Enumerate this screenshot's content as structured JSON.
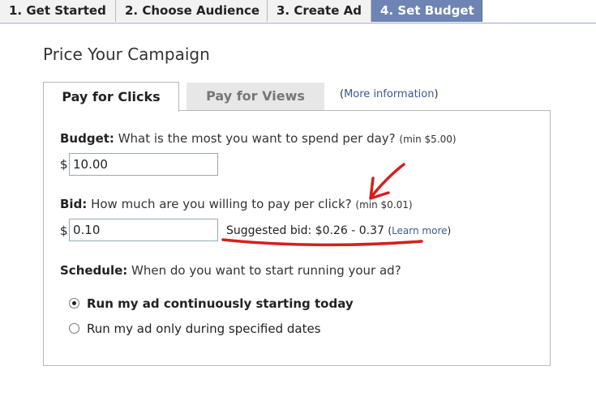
{
  "steps": [
    {
      "label": "1. Get Started"
    },
    {
      "label": "2. Choose Audience"
    },
    {
      "label": "3. Create Ad"
    },
    {
      "label": "4. Set Budget"
    }
  ],
  "title": "Price Your Campaign",
  "tabs": {
    "clicks": "Pay for Clicks",
    "views": "Pay for Views",
    "more_open": "(",
    "more_link": "More information",
    "more_close": ")"
  },
  "budget": {
    "label": "Budget:",
    "question": " What is the most you want to spend per day? ",
    "min": "(min $5.00)",
    "currency": "$",
    "value": "10.00"
  },
  "bid": {
    "label": "Bid:",
    "question": " How much are you willing to pay per click? ",
    "min": "(min $0.01)",
    "currency": "$",
    "value": "0.10",
    "suggested_label": "Suggested bid: $0.26 - 0.37 ",
    "learn_open": "(",
    "learn_link": "Learn more",
    "learn_close": ")"
  },
  "schedule": {
    "label": "Schedule:",
    "question": " When do you want to start running your ad?",
    "options": [
      {
        "label": "Run my ad continuously starting today",
        "selected": true
      },
      {
        "label": "Run my ad only during specified dates",
        "selected": false
      }
    ]
  },
  "colors": {
    "active_step": "#6d84b4",
    "link": "#3b5998",
    "annotation": "#d42020"
  }
}
